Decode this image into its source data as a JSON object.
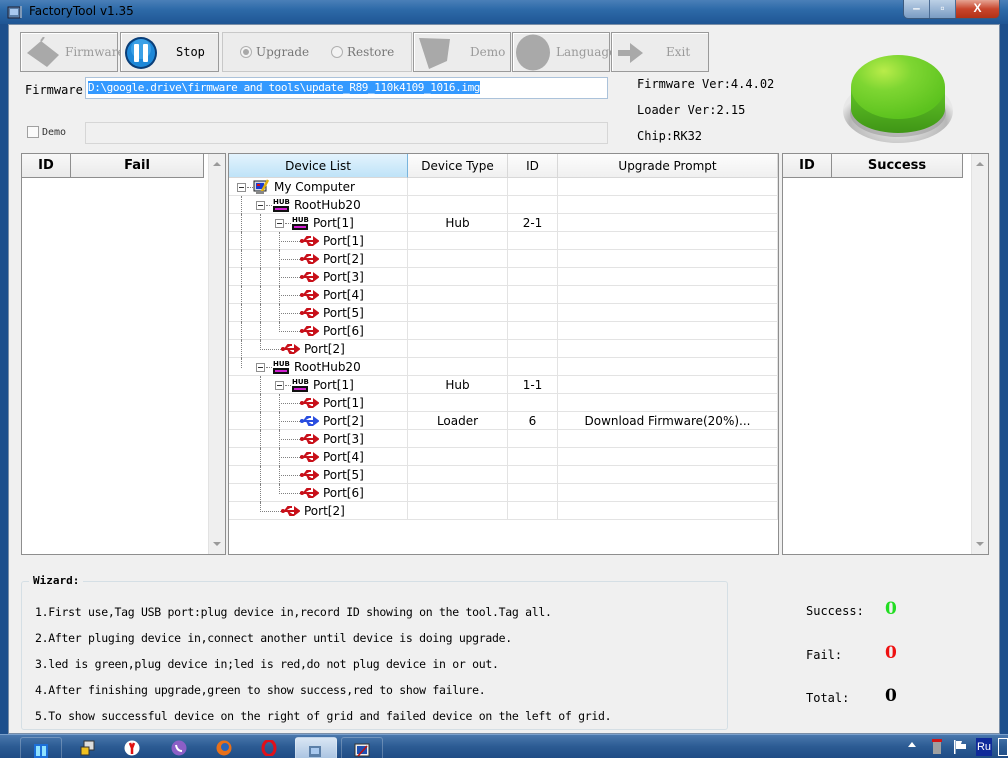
{
  "window": {
    "title": "FactoryTool v1.35",
    "controls": {
      "minimize": "‒",
      "maximize": "▫",
      "close": "X"
    }
  },
  "toolbar": {
    "firmware_label": "Firmware",
    "stop_label": "Stop",
    "upgrade_label": "Upgrade",
    "restore_label": "Restore",
    "demo_label": "Demo",
    "language_label": "Language",
    "exit_label": "Exit",
    "mode_selected": "Upgrade"
  },
  "firmware": {
    "label": "Firmware",
    "path": "D:\\google.drive\\firmware and tools\\update_R89_110k4109_1016.img"
  },
  "demo": {
    "label": "Demo",
    "checked": false,
    "value": ""
  },
  "info": {
    "firmware_ver": "Firmware Ver:4.4.02",
    "loader_ver": "Loader Ver:2.15",
    "chip": "Chip:RK32"
  },
  "status_led": {
    "color": "#66cc22",
    "state": "green"
  },
  "fail_grid": {
    "columns": [
      "ID",
      "Fail"
    ],
    "rows": []
  },
  "success_grid": {
    "columns": [
      "ID",
      "Success"
    ],
    "rows": []
  },
  "device_grid": {
    "columns": [
      "Device List",
      "Device Type",
      "ID",
      "Upgrade Prompt"
    ],
    "rows": [
      {
        "name": "My Computer",
        "level": 0,
        "icon": "computer",
        "type": "",
        "id": "",
        "prompt": ""
      },
      {
        "name": "RootHub20",
        "level": 1,
        "icon": "hub",
        "type": "",
        "id": "",
        "prompt": ""
      },
      {
        "name": "Port[1]",
        "level": 2,
        "icon": "hub",
        "type": "Hub",
        "id": "2-1",
        "prompt": ""
      },
      {
        "name": "Port[1]",
        "level": 3,
        "icon": "usb-red",
        "type": "",
        "id": "",
        "prompt": ""
      },
      {
        "name": "Port[2]",
        "level": 3,
        "icon": "usb-red",
        "type": "",
        "id": "",
        "prompt": ""
      },
      {
        "name": "Port[3]",
        "level": 3,
        "icon": "usb-red",
        "type": "",
        "id": "",
        "prompt": ""
      },
      {
        "name": "Port[4]",
        "level": 3,
        "icon": "usb-red",
        "type": "",
        "id": "",
        "prompt": ""
      },
      {
        "name": "Port[5]",
        "level": 3,
        "icon": "usb-red",
        "type": "",
        "id": "",
        "prompt": ""
      },
      {
        "name": "Port[6]",
        "level": 3,
        "icon": "usb-red",
        "type": "",
        "id": "",
        "prompt": ""
      },
      {
        "name": "Port[2]",
        "level": 2,
        "icon": "usb-red",
        "type": "",
        "id": "",
        "prompt": ""
      },
      {
        "name": "RootHub20",
        "level": 1,
        "icon": "hub",
        "type": "",
        "id": "",
        "prompt": ""
      },
      {
        "name": "Port[1]",
        "level": 2,
        "icon": "hub",
        "type": "Hub",
        "id": "1-1",
        "prompt": ""
      },
      {
        "name": "Port[1]",
        "level": 3,
        "icon": "usb-red",
        "type": "",
        "id": "",
        "prompt": ""
      },
      {
        "name": "Port[2]",
        "level": 3,
        "icon": "usb-blue",
        "type": "Loader",
        "id": "6",
        "prompt": "Download Firmware(20%)..."
      },
      {
        "name": "Port[3]",
        "level": 3,
        "icon": "usb-red",
        "type": "",
        "id": "",
        "prompt": ""
      },
      {
        "name": "Port[4]",
        "level": 3,
        "icon": "usb-red",
        "type": "",
        "id": "",
        "prompt": ""
      },
      {
        "name": "Port[5]",
        "level": 3,
        "icon": "usb-red",
        "type": "",
        "id": "",
        "prompt": ""
      },
      {
        "name": "Port[6]",
        "level": 3,
        "icon": "usb-red",
        "type": "",
        "id": "",
        "prompt": ""
      },
      {
        "name": "Port[2]",
        "level": 2,
        "icon": "usb-red",
        "type": "",
        "id": "",
        "prompt": ""
      }
    ]
  },
  "wizard": {
    "title": "Wizard:",
    "lines": [
      "1.First use,Tag USB port:plug device in,record ID showing on the tool.Tag all.",
      "2.After pluging device in,connect another until device is doing upgrade.",
      "3.led is green,plug device in;led is red,do not plug device in or out.",
      "4.After finishing upgrade,green to show success,red to show failure.",
      "5.To show successful device on the right of grid and failed device on the left of grid."
    ]
  },
  "stats": {
    "success_label": "Success:",
    "success_value": "0",
    "success_color": "#22dd22",
    "fail_label": "Fail:",
    "fail_value": "0",
    "fail_color": "#ee1111",
    "total_label": "Total:",
    "total_value": "0",
    "total_color": "#000000"
  },
  "taskbar": {
    "items": [
      "start-tiles",
      "network-tool",
      "yandex-browser",
      "viber",
      "firefox",
      "opera",
      "factorytool",
      "device-manager"
    ],
    "active": "factorytool",
    "tray": {
      "language": "Ru"
    }
  }
}
